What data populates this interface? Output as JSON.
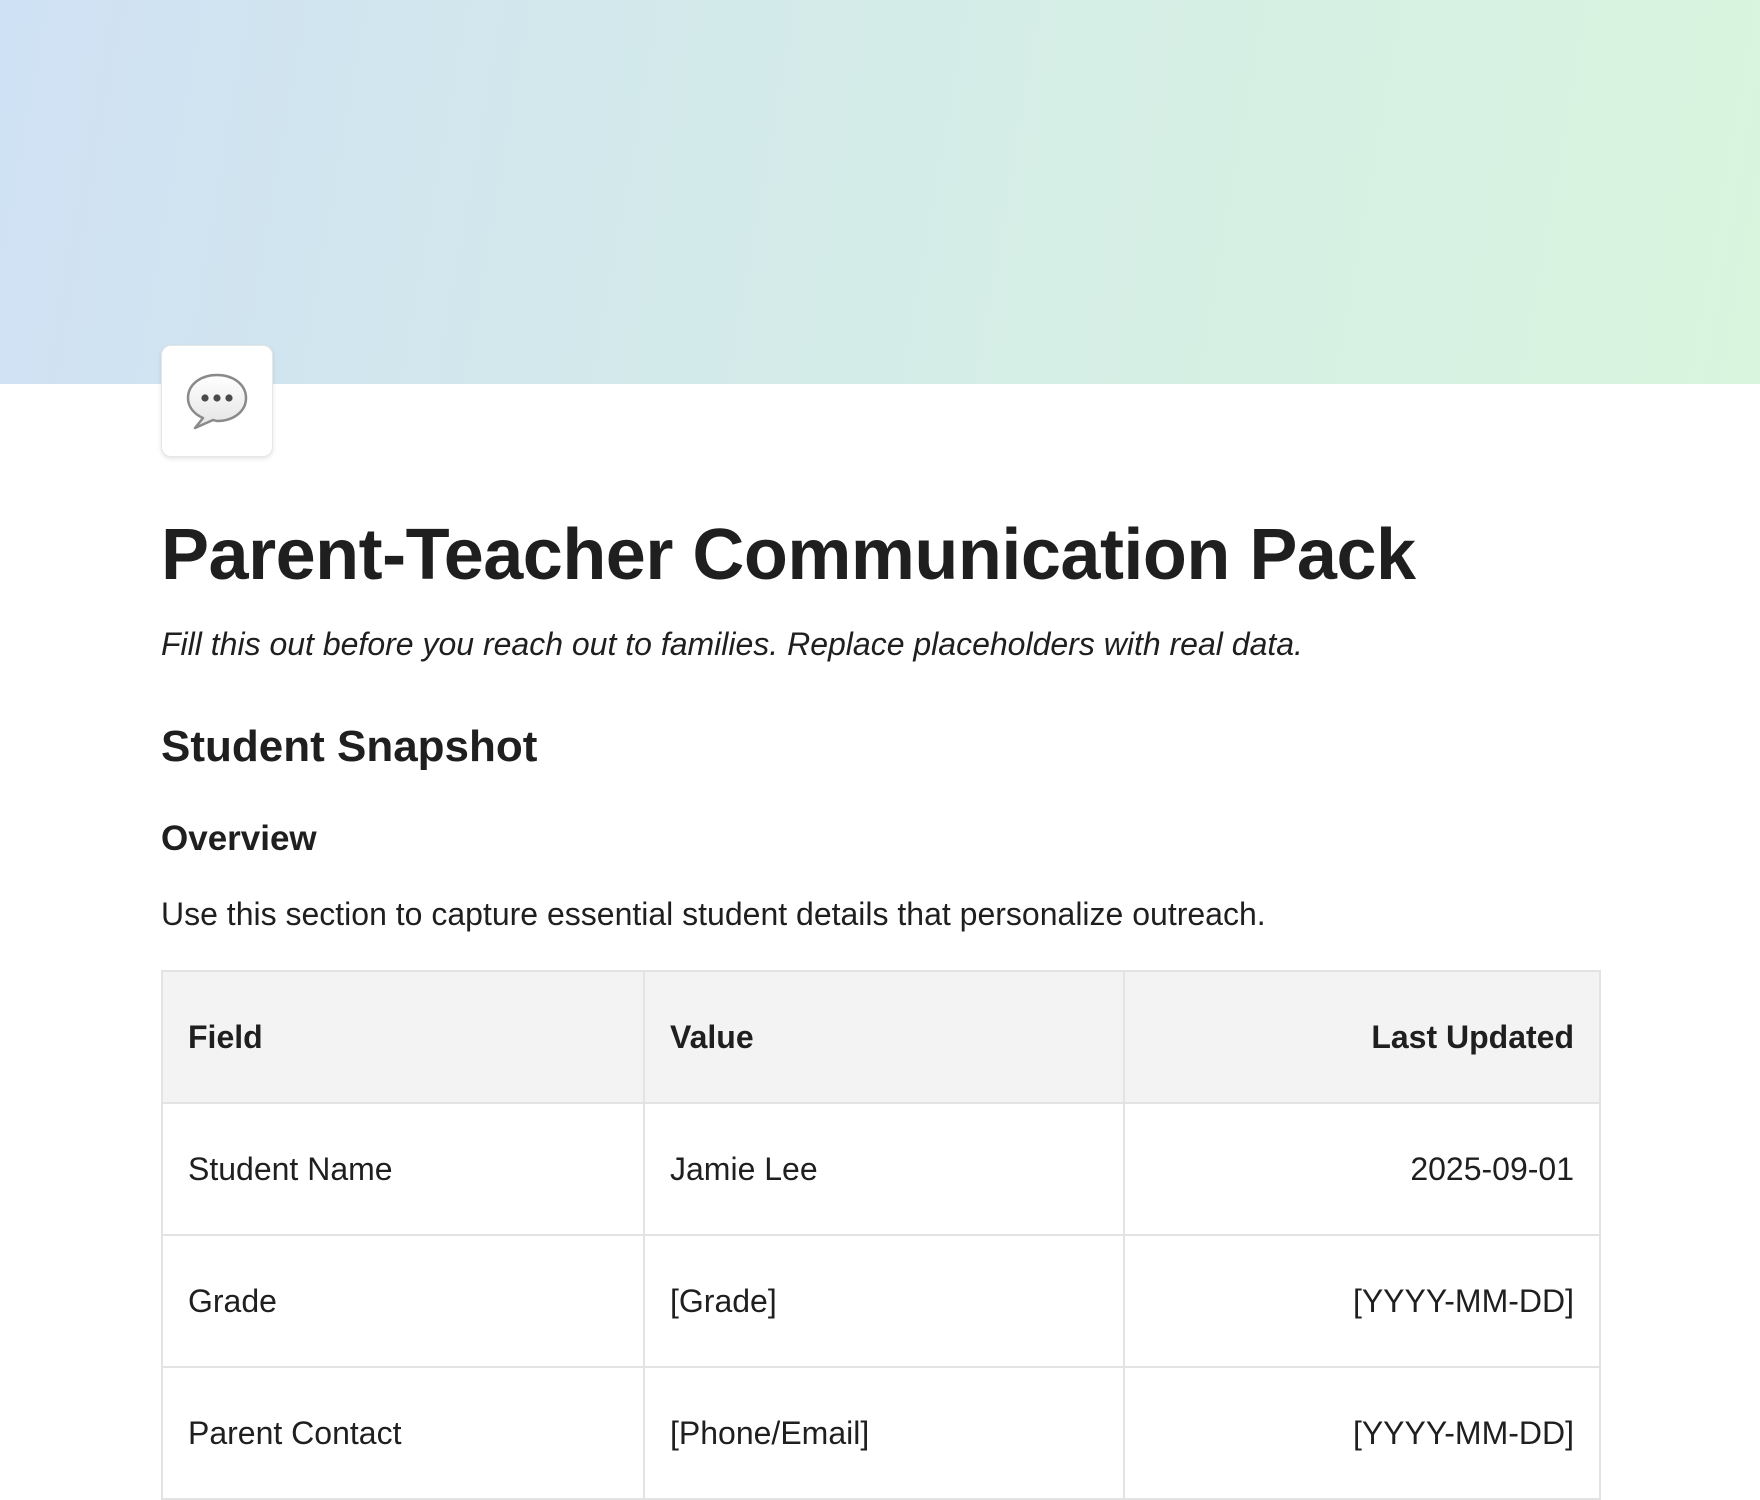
{
  "page": {
    "cover_colors": [
      "#cfe1f4",
      "#d9f5de"
    ],
    "icon": "speech-bubble-icon",
    "title": "Parent-Teacher Communication Pack",
    "subtitle": "Fill this out before you reach out to families. Replace placeholders with real data."
  },
  "section": {
    "heading": "Student Snapshot",
    "subheading": "Overview",
    "intro": "Use this section to capture essential student details that personalize outreach."
  },
  "table": {
    "headers": [
      "Field",
      "Value",
      "Last Updated"
    ],
    "rows": [
      {
        "field": "Student Name",
        "value": "Jamie Lee",
        "updated": "2025-09-01"
      },
      {
        "field": "Grade",
        "value": "[Grade]",
        "updated": "[YYYY-MM-DD]"
      },
      {
        "field": "Parent Contact",
        "value": "[Phone/Email]",
        "updated": "[YYYY-MM-DD]"
      }
    ]
  }
}
